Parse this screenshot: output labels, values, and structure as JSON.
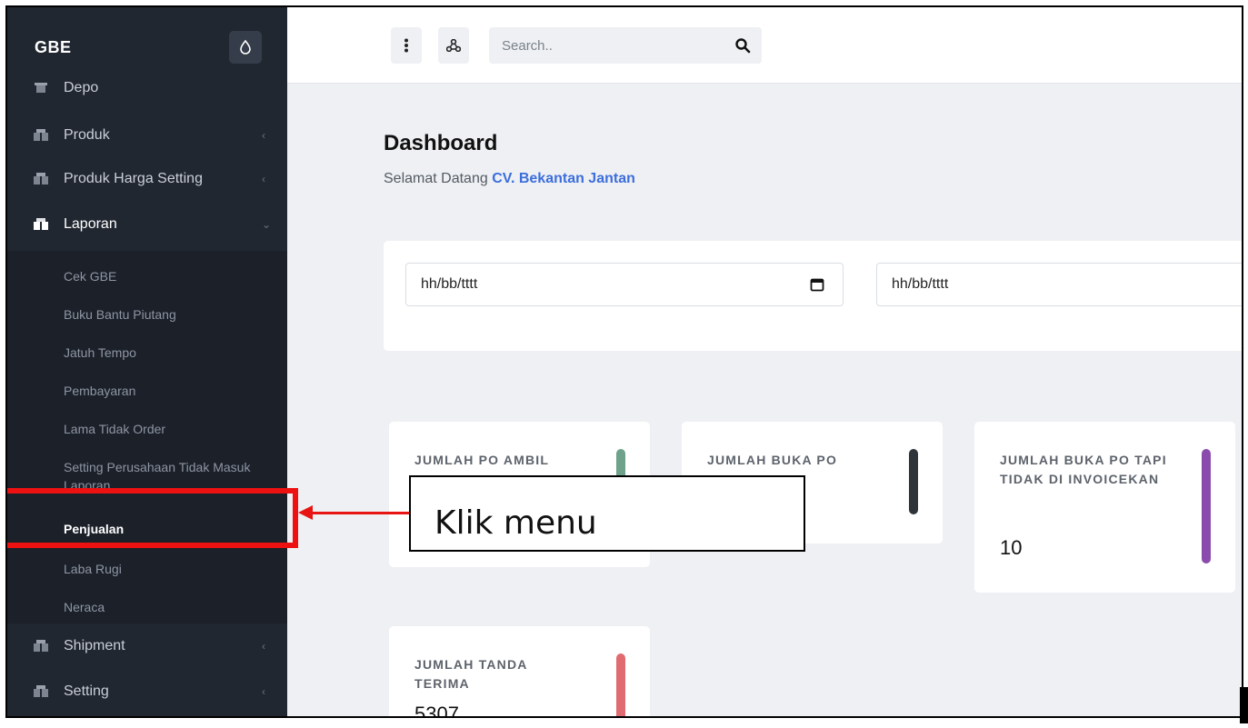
{
  "brand": {
    "name": "GBE",
    "toggle_icon": "droplet-icon"
  },
  "sidebar": {
    "items": [
      {
        "label": "Depo",
        "icon": "box-icon"
      },
      {
        "label": "Produk",
        "icon": "boxes-icon",
        "chevron": "‹"
      },
      {
        "label": "Produk Harga Setting",
        "icon": "boxes-icon",
        "chevron": "‹"
      },
      {
        "label": "Laporan",
        "icon": "boxes-icon",
        "chevron": "⌄"
      },
      {
        "label": "Shipment",
        "icon": "boxes-icon",
        "chevron": "‹"
      },
      {
        "label": "Setting",
        "icon": "boxes-icon",
        "chevron": "‹"
      }
    ],
    "laporan_sub": [
      "Cek GBE",
      "Buku Bantu Piutang",
      "Jatuh Tempo",
      "Pembayaran",
      "Lama Tidak Order",
      "Setting Perusahaan Tidak Masuk Laporan",
      "Penjualan",
      "Laba Rugi",
      "Neraca"
    ]
  },
  "topbar": {
    "menu_icon": "kebab-icon",
    "network_icon": "network-icon",
    "search": {
      "placeholder": "Search..",
      "value": ""
    }
  },
  "main": {
    "title": "Dashboard",
    "welcome_prefix": "Selamat Datang",
    "company": "CV. Bekantan Jantan",
    "date_from": "hh/bb/tttt",
    "date_to": "hh/bb/tttt",
    "cards": [
      {
        "label": "JUMLAH PO AMBIL",
        "value": "",
        "color": "#6ea28a"
      },
      {
        "label": "JUMLAH BUKA PO",
        "value": "",
        "color": "#2f343b"
      },
      {
        "label": "JUMLAH BUKA PO TAPI TIDAK DI INVOICEKAN",
        "value": "10",
        "color": "#8a4bad"
      },
      {
        "label": "JUMLAH TANDA TERIMA",
        "value": "5307",
        "color": "#e06c72"
      }
    ]
  },
  "annotation": {
    "text": "Klik menu",
    "color": "#ee1111"
  }
}
